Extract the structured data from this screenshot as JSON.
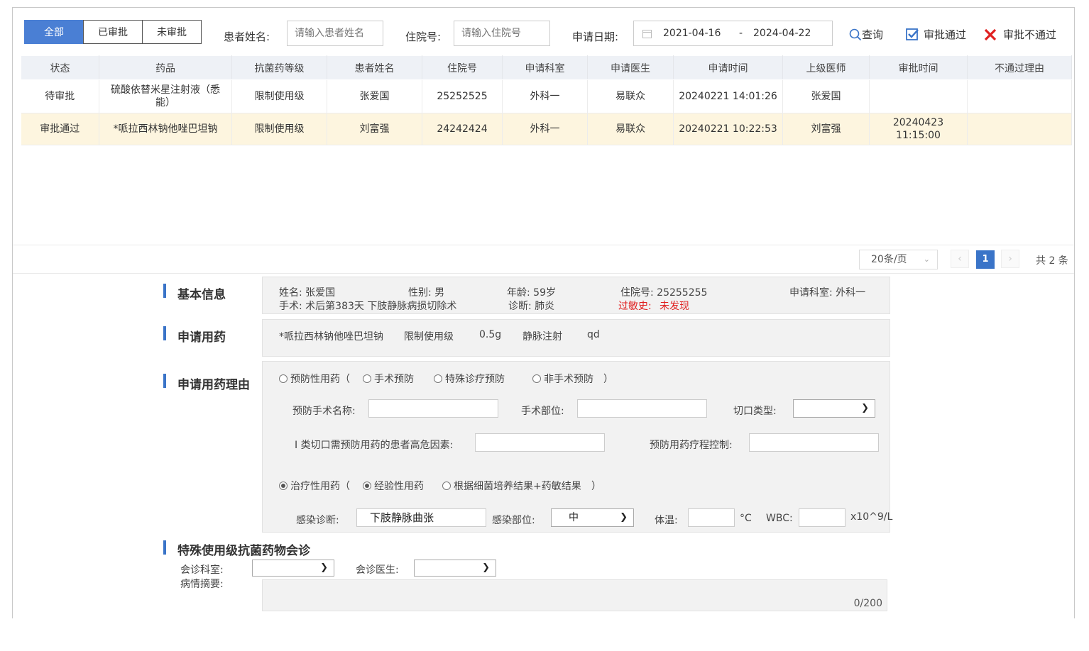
{
  "filter_tabs": [
    "全部",
    "已审批",
    "未审批"
  ],
  "search": {
    "patient_name_label": "患者姓名:",
    "patient_name_placeholder": "请输入患者姓名",
    "inpatient_no_label": "住院号:",
    "inpatient_no_placeholder": "请输入住院号",
    "date_label": "申请日期:",
    "date_start": "2021-04-16",
    "date_sep": "-",
    "date_end": "2024-04-22",
    "query_label": "查询",
    "approve_label": "审批通过",
    "reject_label": "审批不通过"
  },
  "table": {
    "columns": [
      "状态",
      "药品",
      "抗菌药等级",
      "患者姓名",
      "住院号",
      "申请科室",
      "申请医生",
      "申请时间",
      "上级医师",
      "审批时间",
      "不通过理由"
    ],
    "rows": [
      [
        "待审批",
        "硫酸依替米星注射液（悉能）",
        "限制使用级",
        "张爱国",
        "25252525",
        "外科一",
        "易联众",
        "20240221 14:01:26",
        "张爱国",
        "",
        ""
      ],
      [
        "审批通过",
        "*哌拉西林钠他唑巴坦钠",
        "限制使用级",
        "刘富强",
        "24242424",
        "外科一",
        "易联众",
        "20240221 10:22:53",
        "刘富强",
        "20240423 11:15:00",
        ""
      ]
    ]
  },
  "pagination": {
    "page_size": "20条/页",
    "current_page": "1",
    "total": "共 2 条"
  },
  "basic_info": {
    "title": "基本信息",
    "name": "姓名: 张爱国",
    "gender": "性别: 男",
    "age": "年龄: 59岁",
    "inpatient_no": "住院号: 25255255",
    "department": "申请科室: 外科一",
    "surgery": "手术: 术后第383天 下肢静脉病损切除术",
    "diagnosis": "诊断: 肺炎",
    "allergy_label": "过敏史:",
    "allergy_value": "未发现"
  },
  "drug_request": {
    "title": "申请用药",
    "drug": "*哌拉西林钠他唑巴坦钠",
    "level": "限制使用级",
    "dose": "0.5g",
    "route": "静脉注射",
    "frequency": "qd"
  },
  "reason": {
    "title": "申请用药理由",
    "prophylactic": "预防性用药（",
    "surgical": "手术预防",
    "special": "特殊诊疗预防",
    "nonsurgical": "非手术预防",
    "close_paren": "）",
    "surgery_name_label": "预防手术名称:",
    "surgery_site_label": "手术部位:",
    "incision_type_label": "切口类型:",
    "risk_factor_label": "I 类切口需预防用药的患者高危因素:",
    "course_control_label": "预防用药疗程控制:",
    "therapeutic": "治疗性用药（",
    "empirical": "经验性用药",
    "culture_based": "根据细菌培养结果+药敏结果",
    "infection_diag_label": "感染诊断:",
    "infection_diag_value": "下肢静脉曲张",
    "infection_site_label": "感染部位:",
    "infection_site_value": "中",
    "temp_label": "体温:",
    "temp_unit": "°C",
    "wbc_label": "WBC:",
    "wbc_unit": "x10^9/L"
  },
  "consult": {
    "title": "特殊使用级抗菌药物会诊",
    "dept_label": "会诊科室:",
    "doctor_label": "会诊医生:",
    "summary_label": "病情摘要:",
    "char_count": "0/200"
  },
  "colors": {
    "accent": "#4a7fd4",
    "approved_row": "#fdf5df",
    "reject": "#e02020"
  }
}
